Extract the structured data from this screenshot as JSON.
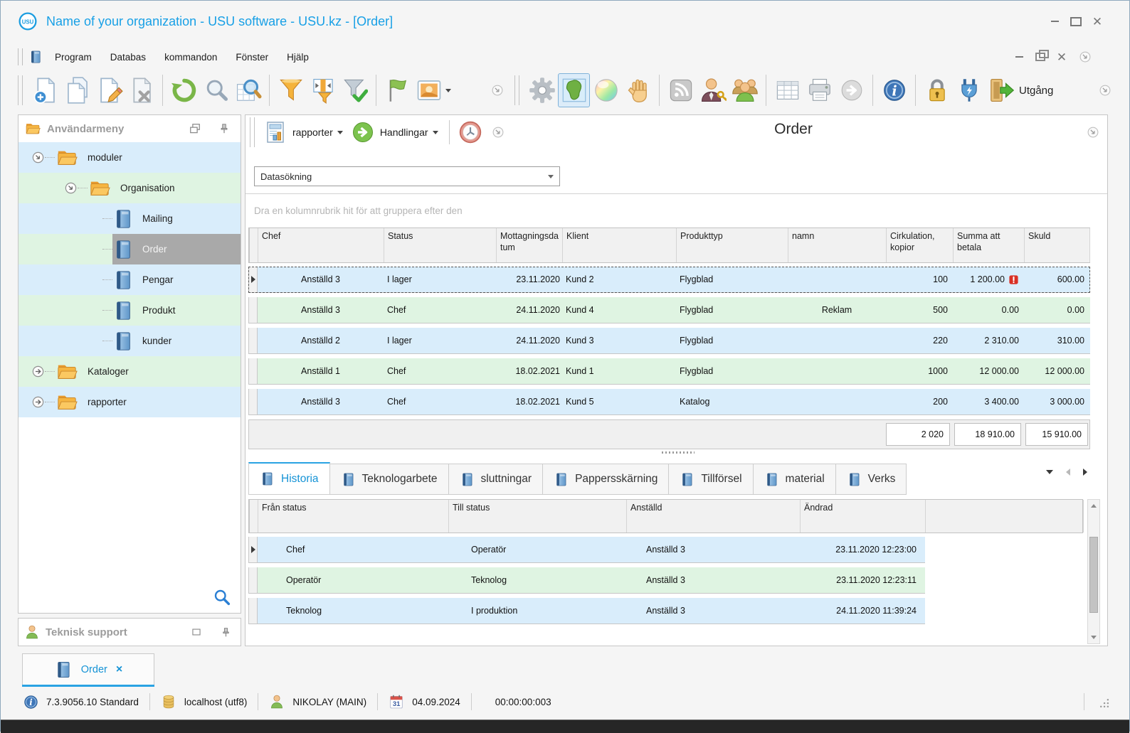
{
  "window": {
    "title": "Name of your organization - USU software - USU.kz - [Order]"
  },
  "menu": {
    "items": [
      "Program",
      "Databas",
      "kommandon",
      "Fönster",
      "Hjälp"
    ]
  },
  "toolbar": {
    "exit_label": "Utgång"
  },
  "panel": {
    "reports_label": "rapporter",
    "actions_label": "Handlingar",
    "title": "Order",
    "search_label": "Datasökning",
    "group_hint": "Dra en kolumnrubrik hit för att gruppera efter den"
  },
  "sidebar": {
    "title": "Användarmeny",
    "support_title": "Teknisk support",
    "tree": [
      {
        "label": "moduler"
      },
      {
        "label": "Organisation"
      },
      {
        "label": "Mailing"
      },
      {
        "label": "Order"
      },
      {
        "label": "Pengar"
      },
      {
        "label": "Produkt"
      },
      {
        "label": "kunder"
      },
      {
        "label": "Kataloger"
      },
      {
        "label": "rapporter"
      }
    ]
  },
  "orders_grid": {
    "columns": [
      "Chef",
      "Status",
      "Mottagningsdatum",
      "Klient",
      "Produkttyp",
      "namn",
      "Cirkulation, kopior",
      "Summa att betala",
      "Skuld"
    ],
    "rows": [
      [
        "Anställd 3",
        "I lager",
        "23.11.2020",
        "Kund 2",
        "Flygblad",
        "",
        "100",
        "1 200.00",
        "600.00"
      ],
      [
        "Anställd 3",
        "Chef",
        "24.11.2020",
        "Kund 4",
        "Flygblad",
        "Reklam",
        "500",
        "0.00",
        "0.00"
      ],
      [
        "Anställd 2",
        "I lager",
        "24.11.2020",
        "Kund 3",
        "Flygblad",
        "",
        "220",
        "2 310.00",
        "310.00"
      ],
      [
        "Anställd 1",
        "Chef",
        "18.02.2021",
        "Kund 1",
        "Flygblad",
        "",
        "1000",
        "12 000.00",
        "12 000.00"
      ],
      [
        "Anställd 3",
        "Chef",
        "18.02.2021",
        "Kund 5",
        "Katalog",
        "",
        "200",
        "3 400.00",
        "3 000.00"
      ]
    ],
    "totals": [
      "2 020",
      "18 910.00",
      "15 910.00"
    ]
  },
  "tabs": {
    "items": [
      "Historia",
      "Teknologarbete",
      "sluttningar",
      "Pappersskärning",
      "Tillförsel",
      "material",
      "Verks"
    ],
    "active": "Historia"
  },
  "history_grid": {
    "columns": [
      "Från status",
      "Till status",
      "Anställd",
      "Ändrad"
    ],
    "rows": [
      [
        "Chef",
        "Operatör",
        "Anställd 3",
        "23.11.2020 12:23:00"
      ],
      [
        "Operatör",
        "Teknolog",
        "Anställd 3",
        "23.11.2020 12:23:11"
      ],
      [
        "Teknolog",
        "I produktion",
        "Anställd 3",
        "24.11.2020 11:39:24"
      ]
    ]
  },
  "document_tabs": {
    "label": "Order",
    "close": "×"
  },
  "statusbar": {
    "version": "7.3.9056.10 Standard",
    "database": "localhost (utf8)",
    "user": "NIKOLAY (MAIN)",
    "calendar_day": "31",
    "date": "04.09.2024",
    "timer": "00:00:00:003"
  }
}
